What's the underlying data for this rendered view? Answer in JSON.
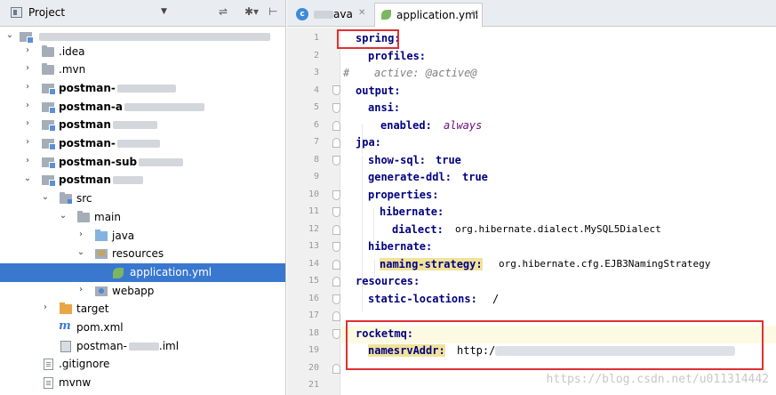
{
  "project_panel": {
    "title": "Project",
    "tree": [
      {
        "label": "",
        "bold": false
      },
      {
        "label": ".idea"
      },
      {
        "label": ".mvn"
      },
      {
        "label": "postman-",
        "bold": true
      },
      {
        "label": "postman-a",
        "bold": true
      },
      {
        "label": "postman",
        "bold": true
      },
      {
        "label": "postman-",
        "bold": true
      },
      {
        "label": "postman-sub",
        "bold": true
      },
      {
        "label": "postman",
        "bold": true
      },
      {
        "label": "src"
      },
      {
        "label": "main"
      },
      {
        "label": "java"
      },
      {
        "label": "resources"
      },
      {
        "label": "application.yml"
      },
      {
        "label": "webapp"
      },
      {
        "label": "target"
      },
      {
        "label": "pom.xml"
      },
      {
        "label": "postman-",
        "suffix": ".iml"
      },
      {
        "label": ".gitignore"
      },
      {
        "label": "mvnw"
      }
    ]
  },
  "editor": {
    "tabs": [
      {
        "label": "ava"
      },
      {
        "label": "application.yml"
      }
    ],
    "line_numbers": [
      "1",
      "2",
      "3",
      "4",
      "5",
      "6",
      "7",
      "8",
      "9",
      "10",
      "11",
      "12",
      "13",
      "14",
      "15",
      "16",
      "17",
      "18",
      "19",
      "20",
      "21"
    ],
    "lines": {
      "l1": "spring:",
      "l2": "profiles:",
      "l3_hash": "#",
      "l3_comment": "active: @active@",
      "l4": "output:",
      "l5": "ansi:",
      "l6_key": "enabled:",
      "l6_val": "always",
      "l7": "jpa:",
      "l8_key": "show-sql:",
      "l8_val": "true",
      "l9_key": "generate-ddl:",
      "l9_val": "true",
      "l10": "properties:",
      "l11": "hibernate:",
      "l12_key": "dialect:",
      "l12_val": "org.hibernate.dialect.MySQL5Dialect",
      "l13": "hibernate:",
      "l14_key": "naming-strategy:",
      "l14_val": "org.hibernate.cfg.EJB3NamingStrategy",
      "l15": "resources:",
      "l16_key": "static-locations:",
      "l16_val": "/",
      "l18": "rocketmq:",
      "l19_key": "namesrvAddr:",
      "l19_val": "http:/"
    },
    "watermark": "https://blog.csdn.net/u011314442"
  }
}
